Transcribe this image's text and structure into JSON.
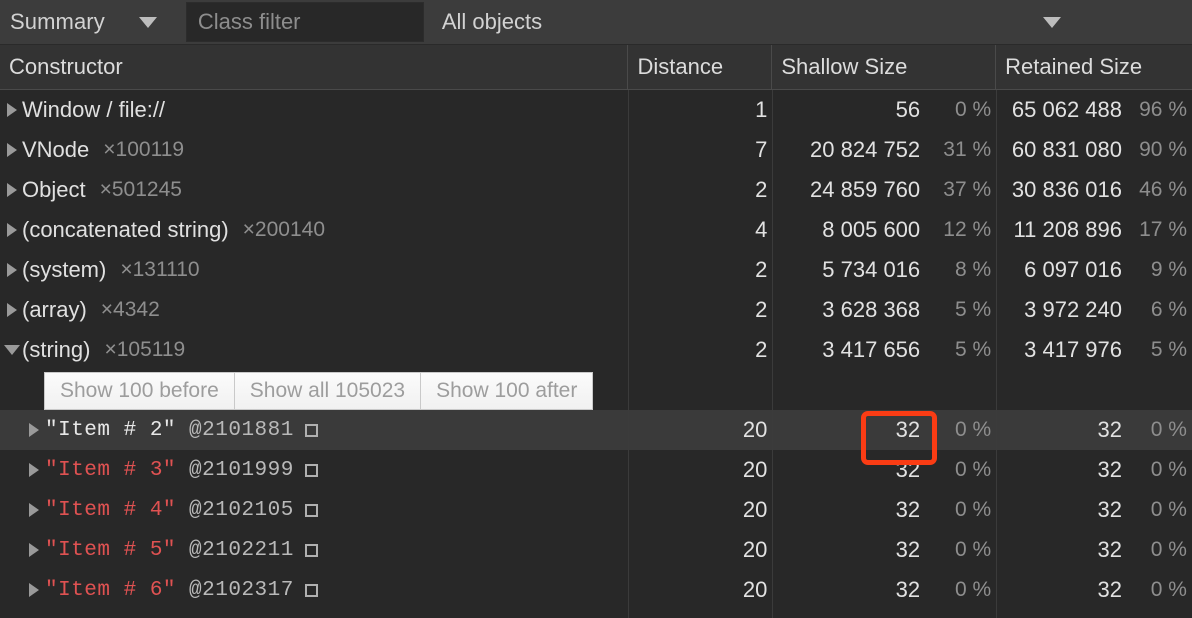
{
  "toolbar": {
    "view_select": "Summary",
    "view_caret_icon": "chevron-down-icon",
    "class_filter_placeholder": "Class filter",
    "class_filter_value": "",
    "objects_select": "All objects",
    "objects_caret_icon": "chevron-down-icon"
  },
  "grid": {
    "columns": [
      {
        "key": "constructor",
        "label": "Constructor"
      },
      {
        "key": "distance",
        "label": "Distance"
      },
      {
        "key": "shallow",
        "label": "Shallow Size"
      },
      {
        "key": "retained",
        "label": "Retained Size"
      }
    ],
    "rows": [
      {
        "type": "constructor",
        "name": "Window / file://",
        "count": "",
        "expanded": false,
        "distance": "1",
        "shallow": "56",
        "shallow_pct": "0 %",
        "retained": "65 062 488",
        "retained_pct": "96 %"
      },
      {
        "type": "constructor",
        "name": "VNode",
        "count": "×100119",
        "expanded": false,
        "distance": "7",
        "shallow": "20 824 752",
        "shallow_pct": "31 %",
        "retained": "60 831 080",
        "retained_pct": "90 %"
      },
      {
        "type": "constructor",
        "name": "Object",
        "count": "×501245",
        "expanded": false,
        "distance": "2",
        "shallow": "24 859 760",
        "shallow_pct": "37 %",
        "retained": "30 836 016",
        "retained_pct": "46 %"
      },
      {
        "type": "constructor",
        "name": "(concatenated string)",
        "count": "×200140",
        "expanded": false,
        "distance": "4",
        "shallow": "8 005 600",
        "shallow_pct": "12 %",
        "retained": "11 208 896",
        "retained_pct": "17 %"
      },
      {
        "type": "constructor",
        "name": "(system)",
        "count": "×131110",
        "expanded": false,
        "distance": "2",
        "shallow": "5 734 016",
        "shallow_pct": "8 %",
        "retained": "6 097 016",
        "retained_pct": "9 %"
      },
      {
        "type": "constructor",
        "name": "(array)",
        "count": "×4342",
        "expanded": false,
        "distance": "2",
        "shallow": "3 628 368",
        "shallow_pct": "5 %",
        "retained": "3 972 240",
        "retained_pct": "6 %"
      },
      {
        "type": "constructor",
        "name": "(string)",
        "count": "×105119",
        "expanded": true,
        "distance": "2",
        "shallow": "3 417 656",
        "shallow_pct": "5 %",
        "retained": "3 417 976",
        "retained_pct": "5 %"
      },
      {
        "type": "show-more",
        "buttons": [
          "Show 100 before",
          "Show all 105023",
          "Show 100 after"
        ]
      },
      {
        "type": "string",
        "value": "\"Item # 2\"",
        "address": "@2101881",
        "hovered": true,
        "distance": "20",
        "shallow": "32",
        "shallow_pct": "0 %",
        "retained": "32",
        "retained_pct": "0 %"
      },
      {
        "type": "string",
        "value": "\"Item # 3\"",
        "address": "@2101999",
        "hovered": false,
        "distance": "20",
        "shallow": "32",
        "shallow_pct": "0 %",
        "retained": "32",
        "retained_pct": "0 %"
      },
      {
        "type": "string",
        "value": "\"Item # 4\"",
        "address": "@2102105",
        "hovered": false,
        "distance": "20",
        "shallow": "32",
        "shallow_pct": "0 %",
        "retained": "32",
        "retained_pct": "0 %"
      },
      {
        "type": "string",
        "value": "\"Item # 5\"",
        "address": "@2102211",
        "hovered": false,
        "distance": "20",
        "shallow": "32",
        "shallow_pct": "0 %",
        "retained": "32",
        "retained_pct": "0 %"
      },
      {
        "type": "string",
        "value": "\"Item # 6\"",
        "address": "@2102317",
        "hovered": false,
        "distance": "20",
        "shallow": "32",
        "shallow_pct": "0 %",
        "retained": "32",
        "retained_pct": "0 %"
      }
    ]
  },
  "annotation": {
    "shape": "rounded-rect-highlight",
    "color": "#fa3c14",
    "target": "shallow-size-value-of-item-2"
  },
  "colors": {
    "background": "#282828",
    "toolbar": "#3c3c3c",
    "header": "#333333",
    "hover_row": "#3a3a3a",
    "string_value": "#e05252",
    "muted_text": "#8e8e8e",
    "annotation": "#fa3c14"
  }
}
